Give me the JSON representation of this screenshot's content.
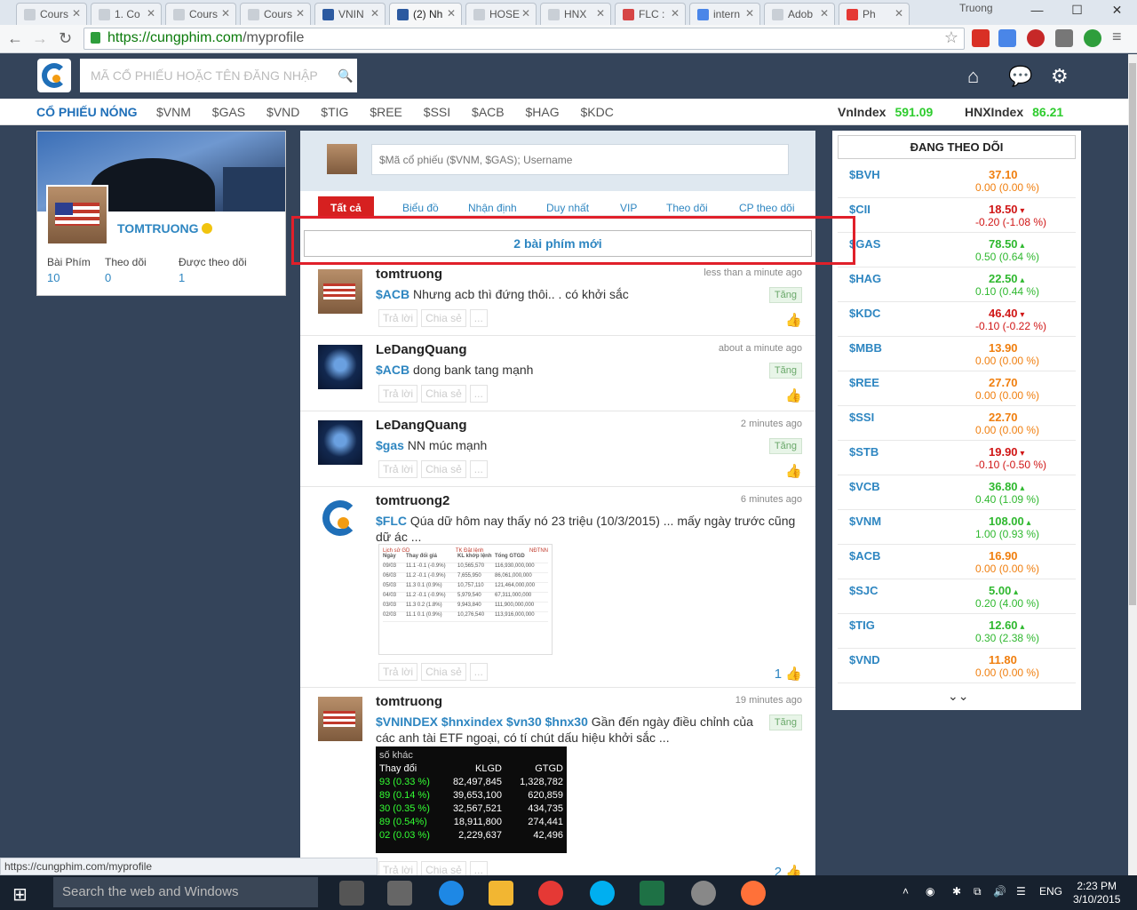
{
  "browser": {
    "tabs": [
      "Cours",
      "1. Co",
      "Cours",
      "Cours",
      "VNIN",
      "(2) Nh",
      "HOSE",
      "HNX",
      "FLC :",
      "intern",
      "Adob",
      "Ph"
    ],
    "profile": "Truong",
    "url_host": "https://cungphim.com",
    "url_path": "/myprofile",
    "status_url": "https://cungphim.com/myprofile"
  },
  "header": {
    "search_placeholder": "MÃ CỔ PHIẾU HOẶC TÊN ĐĂNG NHẬP"
  },
  "hotbar": {
    "label": "CỔ PHIẾU NÓNG",
    "items": [
      "$VNM",
      "$GAS",
      "$VND",
      "$TIG",
      "$REE",
      "$SSI",
      "$ACB",
      "$HAG",
      "$KDC"
    ],
    "vnindex_label": "VnIndex",
    "vnindex_value": "591.09",
    "hnxindex_label": "HNXIndex",
    "hnxindex_value": "86.21"
  },
  "profile": {
    "username": "TOMTRUONG",
    "stats": [
      {
        "label": "Bài Phím",
        "value": "10"
      },
      {
        "label": "Theo dõi",
        "value": "0"
      },
      {
        "label": "Được theo dõi",
        "value": "1"
      }
    ]
  },
  "composer": {
    "placeholder": "$Mã cổ phiếu ($VNM, $GAS); Username"
  },
  "feed_tabs": [
    "Tất cả",
    "Biểu đồ",
    "Nhận định",
    "Duy nhất",
    "VIP",
    "Theo dõi",
    "CP theo dõi"
  ],
  "new_posts": "2 bài phím mới",
  "actions": {
    "reply": "Trả lời",
    "share": "Chia sẻ",
    "more": "..."
  },
  "posts": [
    {
      "author": "tomtruong",
      "time": "less than a minute ago",
      "ticker": "$ACB",
      "text": " Nhưng acb thì đứng thôi.. . có khởi sắc",
      "tag": "Tăng",
      "likes": ""
    },
    {
      "author": "LeDangQuang",
      "time": "about a minute ago",
      "ticker": "$ACB",
      "text": " dong bank tang mạnh",
      "tag": "Tăng",
      "likes": ""
    },
    {
      "author": "LeDangQuang",
      "time": "2 minutes ago",
      "ticker": "$gas",
      "text": " NN múc mạnh",
      "tag": "Tăng",
      "likes": ""
    },
    {
      "author": "tomtruong2",
      "time": "6 minutes ago",
      "ticker": "$FLC",
      "text": " Qúa dữ hôm nay thấy nó 23 triệu (10/3/2015) ... mấy ngày trước cũng dữ ác ...",
      "tag": "",
      "likes": "1"
    },
    {
      "author": "tomtruong",
      "time": "19 minutes ago",
      "ticker": "$VNINDEX $hnxindex $vn30 $hnx30",
      "text": " Gần đến ngày điều chỉnh của các anh tài ETF ngoại, có tí chút dấu hiệu khởi sắc ...",
      "tag": "Tăng",
      "likes": "2"
    }
  ],
  "flc_table": {
    "tabs": [
      "Lịch sử GD",
      "TK Đặt lệnh",
      "NĐTNN"
    ],
    "headers": [
      "Ngày",
      "Thay đổi giá",
      "KL khớp lệnh",
      "Tổng GTGD"
    ],
    "rows": [
      [
        "09/03",
        "11.1 -0.1 (-0.9%)",
        "10,565,570",
        "116,930,000,000"
      ],
      [
        "06/03",
        "11.2 -0.1 (-0.9%)",
        "7,655,950",
        "86,061,000,000"
      ],
      [
        "05/03",
        "11.3 0.1 (0.9%)",
        "10,757,110",
        "121,464,000,000"
      ],
      [
        "04/03",
        "11.2 -0.1 (-0.9%)",
        "5,979,540",
        "67,311,000,000"
      ],
      [
        "03/03",
        "11.3 0.2 (1.8%)",
        "9,943,840",
        "111,900,000,000"
      ],
      [
        "02/03",
        "11.1 0.1 (0.9%)",
        "10,276,540",
        "113,916,000,000"
      ]
    ]
  },
  "index_table": {
    "title": "số khác",
    "headers": [
      "Thay đổi",
      "KLGD",
      "GTGD"
    ],
    "rows": [
      [
        "93 (0.33 %)",
        "82,497,845",
        "1,328,782"
      ],
      [
        "89 (0.14 %)",
        "39,653,100",
        "620,859"
      ],
      [
        "30 (0.35 %)",
        "32,567,521",
        "434,735"
      ],
      [
        "89 (0.54%)",
        "18,911,800",
        "274,441"
      ],
      [
        "02 (0.03 %)",
        "2,229,637",
        "42,496"
      ]
    ]
  },
  "following": {
    "title": "ĐANG THEO DÕI",
    "items": [
      {
        "sym": "$BVH",
        "price": "37.10",
        "change": "0.00 (0.00 %)",
        "dir": "flat"
      },
      {
        "sym": "$CII",
        "price": "18.50",
        "change": "-0.20 (-1.08 %)",
        "dir": "down"
      },
      {
        "sym": "$GAS",
        "price": "78.50",
        "change": "0.50 (0.64 %)",
        "dir": "up"
      },
      {
        "sym": "$HAG",
        "price": "22.50",
        "change": "0.10 (0.44 %)",
        "dir": "up"
      },
      {
        "sym": "$KDC",
        "price": "46.40",
        "change": "-0.10 (-0.22 %)",
        "dir": "down"
      },
      {
        "sym": "$MBB",
        "price": "13.90",
        "change": "0.00 (0.00 %)",
        "dir": "flat"
      },
      {
        "sym": "$REE",
        "price": "27.70",
        "change": "0.00 (0.00 %)",
        "dir": "flat"
      },
      {
        "sym": "$SSI",
        "price": "22.70",
        "change": "0.00 (0.00 %)",
        "dir": "flat"
      },
      {
        "sym": "$STB",
        "price": "19.90",
        "change": "-0.10 (-0.50 %)",
        "dir": "down"
      },
      {
        "sym": "$VCB",
        "price": "36.80",
        "change": "0.40 (1.09 %)",
        "dir": "up"
      },
      {
        "sym": "$VNM",
        "price": "108.00",
        "change": "1.00 (0.93 %)",
        "dir": "up"
      },
      {
        "sym": "$ACB",
        "price": "16.90",
        "change": "0.00 (0.00 %)",
        "dir": "flat"
      },
      {
        "sym": "$SJC",
        "price": "5.00",
        "change": "0.20 (4.00 %)",
        "dir": "up"
      },
      {
        "sym": "$TIG",
        "price": "12.60",
        "change": "0.30 (2.38 %)",
        "dir": "up"
      },
      {
        "sym": "$VND",
        "price": "11.80",
        "change": "0.00 (0.00 %)",
        "dir": "flat"
      }
    ]
  },
  "taskbar": {
    "search": "Search the web and Windows",
    "lang": "ENG",
    "time": "2:23 PM",
    "date": "3/10/2015"
  },
  "colors": {
    "header_bg": "#34445a",
    "accent": "#2e86c1",
    "up": "#2fb82f",
    "down": "#d01616",
    "flat": "#f07f0f",
    "highlight": "#e0202a"
  }
}
